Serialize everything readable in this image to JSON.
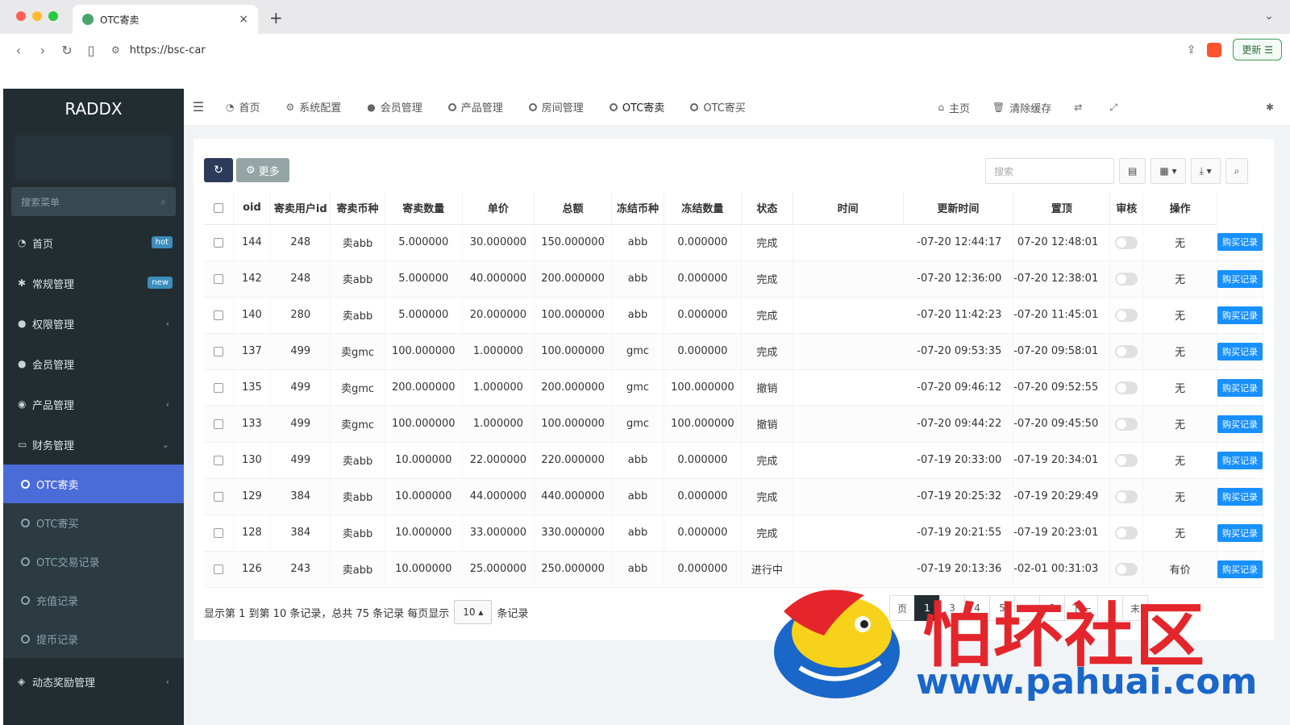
{
  "browser": {
    "tab_title": "OTC寄卖",
    "url": "https://bsc-car",
    "update_label": "更新"
  },
  "sidebar": {
    "brand": "RADDX",
    "search_placeholder": "搜索菜单",
    "items": [
      {
        "label": "首页",
        "icon": "dashboard-icon",
        "badge": "hot"
      },
      {
        "label": "常规管理",
        "icon": "cogs-icon",
        "badge": "new"
      },
      {
        "label": "权限管理",
        "icon": "group-icon",
        "caret": "<"
      },
      {
        "label": "会员管理",
        "icon": "user-icon"
      },
      {
        "label": "产品管理",
        "icon": "product-icon",
        "caret": "<"
      },
      {
        "label": "财务管理",
        "icon": "finance-icon",
        "caret": "v"
      }
    ],
    "sub_items": [
      {
        "label": "OTC寄卖",
        "active": true
      },
      {
        "label": "OTC寄买"
      },
      {
        "label": "OTC交易记录"
      },
      {
        "label": "充值记录"
      },
      {
        "label": "提币记录"
      }
    ],
    "bottom_item": {
      "label": "动态奖励管理",
      "icon": "reward-icon",
      "caret": "<"
    }
  },
  "topnav": {
    "tabs": [
      {
        "label": "首页",
        "icon": "dashboard-icon"
      },
      {
        "label": "系统配置",
        "icon": "gear-icon"
      },
      {
        "label": "会员管理",
        "icon": "user-icon"
      },
      {
        "label": "产品管理",
        "icon": "circle-icon"
      },
      {
        "label": "房间管理",
        "icon": "circle-icon"
      },
      {
        "label": "OTC寄卖",
        "icon": "circle-icon",
        "active": true
      },
      {
        "label": "OTC寄买",
        "icon": "circle-icon"
      }
    ],
    "right": {
      "home_label": "主页",
      "clear_cache_label": "清除缓存"
    }
  },
  "toolbar": {
    "more_label": "更多",
    "search_placeholder": "搜索"
  },
  "table": {
    "headers": [
      "oid",
      "寄卖用户id",
      "寄卖币种",
      "寄卖数量",
      "单价",
      "总额",
      "冻结币种",
      "冻结数量",
      "状态",
      "时间",
      "更新时间",
      "置顶",
      "审核",
      "操作"
    ],
    "rows": [
      {
        "oid": "144",
        "uid": "248",
        "coin": "卖abb",
        "qty": "5.000000",
        "price": "30.000000",
        "total": "150.000000",
        "fcoin": "abb",
        "fqty": "0.000000",
        "status": "完成",
        "time": "-07-20 12:44:17",
        "utime": "07-20 12:48:01",
        "audit": "无",
        "action": "购买记录"
      },
      {
        "oid": "142",
        "uid": "248",
        "coin": "卖abb",
        "qty": "5.000000",
        "price": "40.000000",
        "total": "200.000000",
        "fcoin": "abb",
        "fqty": "0.000000",
        "status": "完成",
        "time": "-07-20 12:36:00",
        "utime": "-07-20 12:38:01",
        "audit": "无",
        "action": "购买记录"
      },
      {
        "oid": "140",
        "uid": "280",
        "coin": "卖abb",
        "qty": "5.000000",
        "price": "20.000000",
        "total": "100.000000",
        "fcoin": "abb",
        "fqty": "0.000000",
        "status": "完成",
        "time": "-07-20 11:42:23",
        "utime": "-07-20 11:45:01",
        "audit": "无",
        "action": "购买记录"
      },
      {
        "oid": "137",
        "uid": "499",
        "coin": "卖gmc",
        "qty": "100.000000",
        "price": "1.000000",
        "total": "100.000000",
        "fcoin": "gmc",
        "fqty": "0.000000",
        "status": "完成",
        "time": "-07-20 09:53:35",
        "utime": "-07-20 09:58:01",
        "audit": "无",
        "action": "购买记录"
      },
      {
        "oid": "135",
        "uid": "499",
        "coin": "卖gmc",
        "qty": "200.000000",
        "price": "1.000000",
        "total": "200.000000",
        "fcoin": "gmc",
        "fqty": "100.000000",
        "status": "撤销",
        "time": "-07-20 09:46:12",
        "utime": "-07-20 09:52:55",
        "audit": "无",
        "action": "购买记录"
      },
      {
        "oid": "133",
        "uid": "499",
        "coin": "卖gmc",
        "qty": "100.000000",
        "price": "1.000000",
        "total": "100.000000",
        "fcoin": "gmc",
        "fqty": "100.000000",
        "status": "撤销",
        "time": "-07-20 09:44:22",
        "utime": "-07-20 09:45:50",
        "audit": "无",
        "action": "购买记录"
      },
      {
        "oid": "130",
        "uid": "499",
        "coin": "卖abb",
        "qty": "10.000000",
        "price": "22.000000",
        "total": "220.000000",
        "fcoin": "abb",
        "fqty": "0.000000",
        "status": "完成",
        "time": "-07-19 20:33:00",
        "utime": "-07-19 20:34:01",
        "audit": "无",
        "action": "购买记录"
      },
      {
        "oid": "129",
        "uid": "384",
        "coin": "卖abb",
        "qty": "10.000000",
        "price": "44.000000",
        "total": "440.000000",
        "fcoin": "abb",
        "fqty": "0.000000",
        "status": "完成",
        "time": "-07-19 20:25:32",
        "utime": "-07-19 20:29:49",
        "audit": "无",
        "action": "购买记录"
      },
      {
        "oid": "128",
        "uid": "384",
        "coin": "卖abb",
        "qty": "10.000000",
        "price": "33.000000",
        "total": "330.000000",
        "fcoin": "abb",
        "fqty": "0.000000",
        "status": "完成",
        "time": "-07-19 20:21:55",
        "utime": "-07-19 20:23:01",
        "audit": "无",
        "action": "购买记录"
      },
      {
        "oid": "126",
        "uid": "243",
        "coin": "卖abb",
        "qty": "10.000000",
        "price": "25.000000",
        "total": "250.000000",
        "fcoin": "abb",
        "fqty": "0.000000",
        "status": "进行中",
        "time": "-07-19 20:13:36",
        "utime": "-02-01 00:31:03",
        "audit": "有价",
        "action": "购买记录"
      }
    ]
  },
  "footer": {
    "summary": "显示第 1 到第 10 条记录，总共 75 条记录 每页显示",
    "page_size": "10",
    "suffix": "条记录",
    "pages": [
      "页",
      "1",
      "3",
      "4",
      "5",
      "...",
      "8",
      "下一",
      "",
      "末"
    ]
  },
  "watermark": {
    "title": "怕坏社区",
    "url": "www.pahuai.com"
  },
  "colors": {
    "sidebar_bg": "#222d32",
    "active_menu": "#4a6cd8",
    "status_done": "#e55555",
    "status_running": "#3bab6a",
    "coin_abb": "#c85f4b",
    "coin_gmc": "#3bab6a",
    "action_btn": "#1890ff"
  }
}
